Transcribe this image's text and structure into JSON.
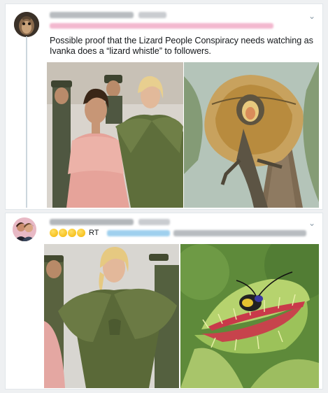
{
  "tweet1": {
    "text": "Possible proof that the Lizard People Conspiracy needs watching as Ivanka does a “lizard whistle” to followers.",
    "menu_icon": "chevron-down-icon",
    "avatar_icon": "profile-avatar",
    "images": [
      "photo-woman-pink-dress-and-green-dress",
      "photo-frilled-lizard"
    ]
  },
  "tweet2": {
    "emojis": [
      "laughing-emoji",
      "rofl-emoji",
      "laughing-emoji",
      "rofl-emoji"
    ],
    "rt_label": "RT",
    "menu_icon": "chevron-down-icon",
    "avatar_icon": "profile-avatar-two-people",
    "images": [
      "photo-woman-green-dress",
      "photo-venus-flytrap-insect"
    ]
  },
  "colors": {
    "text": "#14171a",
    "muted": "#8899a6",
    "link": "#1da1f2",
    "background": "#eef0f2"
  }
}
